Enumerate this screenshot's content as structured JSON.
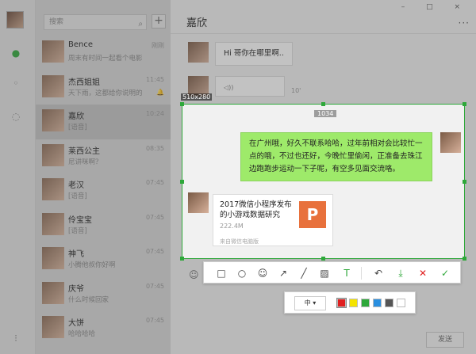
{
  "sidebar": {
    "icons": [
      "chat-icon",
      "contacts-icon",
      "favorites-icon",
      "menu-icon"
    ]
  },
  "search": {
    "placeholder": "搜索",
    "add_label": "+"
  },
  "contacts": [
    {
      "name": "Bence",
      "sub": "周末有时间一起看个电影",
      "time": "刚刚"
    },
    {
      "name": "杰西姐姐",
      "sub": "天下雨，这都给你说明的",
      "time": "11:45",
      "mute": "🔔"
    },
    {
      "name": "嘉欣",
      "sub": "[语音]",
      "time": "10:24",
      "active": true
    },
    {
      "name": "莱西公主",
      "sub": "尼讲咪啊？",
      "time": "08:35"
    },
    {
      "name": "老汉",
      "sub": "[语音]",
      "time": "07:45"
    },
    {
      "name": "伶宝宝",
      "sub": "[语音]",
      "time": "07:45"
    },
    {
      "name": "神飞",
      "sub": "小腾他叔你好啊",
      "time": "07:45"
    },
    {
      "name": "庆爷",
      "sub": "什么时候回家",
      "time": "07:45"
    },
    {
      "name": "大饼",
      "sub": "哈哈哈哈",
      "time": "07:45"
    }
  ],
  "chat": {
    "title": "嘉欣",
    "window_controls": "– □ ×",
    "more": "···",
    "msg1": "Hi 哥你在哪里啊..",
    "voice_icon": "◁))",
    "voice_len": "10'",
    "msg2": "在广州哦，好久不联系哈哈，过年前相对会比较忙一点的哦，不过也还好，今晚忙里偷闲，正准备去珠江边跑跑步运动一下子呢，有空多见面交流咯。",
    "file": {
      "title": "2017微信小程序发布的小游戏数据研究",
      "size": "222.4M",
      "source": "来自微信电脑版",
      "icon_letter": "P"
    },
    "emoji": "☺",
    "send": "发送"
  },
  "capture": {
    "size_label": "510x280",
    "center_label": "1034"
  },
  "toolbar": {
    "tools": [
      {
        "name": "rect-tool",
        "glyph": "□"
      },
      {
        "name": "ellipse-tool",
        "glyph": "○"
      },
      {
        "name": "emoji-tool",
        "glyph": "☺"
      },
      {
        "name": "arrow-tool",
        "glyph": "↗"
      },
      {
        "name": "pen-tool",
        "glyph": "╱"
      },
      {
        "name": "mosaic-tool",
        "glyph": "▨"
      },
      {
        "name": "text-tool",
        "glyph": "T"
      },
      {
        "name": "undo-tool",
        "glyph": "↶"
      },
      {
        "name": "save-tool",
        "glyph": "⤓"
      },
      {
        "name": "cancel-tool",
        "glyph": "✕"
      },
      {
        "name": "confirm-tool",
        "glyph": "✓"
      }
    ],
    "size_option": "中 ▾",
    "colors": [
      "#e02020",
      "#f5e400",
      "#2ea83a",
      "#2a8fe0",
      "#555555",
      "#ffffff"
    ],
    "accent": "#2ea83a"
  }
}
